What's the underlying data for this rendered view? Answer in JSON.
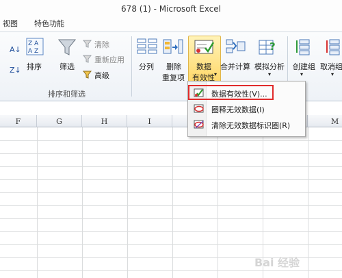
{
  "window": {
    "title": "678 (1)  -  Microsoft Excel"
  },
  "tabs": [
    "视图",
    "特色功能"
  ],
  "ribbon": {
    "sort_filter": {
      "sort_label": "排序",
      "filter_label": "筛选",
      "clear_label": "清除",
      "reapply_label": "重新应用",
      "advanced_label": "高级",
      "caption": "排序和筛选"
    },
    "data_tools": {
      "split_label": "分列",
      "remove_dup_label1": "删除",
      "remove_dup_label2": "重复项",
      "validation_label1": "数据",
      "validation_label2": "有效性",
      "consolidate_label": "合并计算",
      "whatif_label": "模拟分析"
    },
    "outline": {
      "group_label": "创建组",
      "ungroup_label": "取消组"
    }
  },
  "menu": {
    "items": [
      {
        "label": "数据有效性(V)..."
      },
      {
        "label": "圈释无效数据(I)"
      },
      {
        "label": "清除无效数据标识圈(R)"
      }
    ]
  },
  "columns": [
    "F",
    "G",
    "H",
    "I",
    "M"
  ],
  "watermark": "Bai 经验"
}
